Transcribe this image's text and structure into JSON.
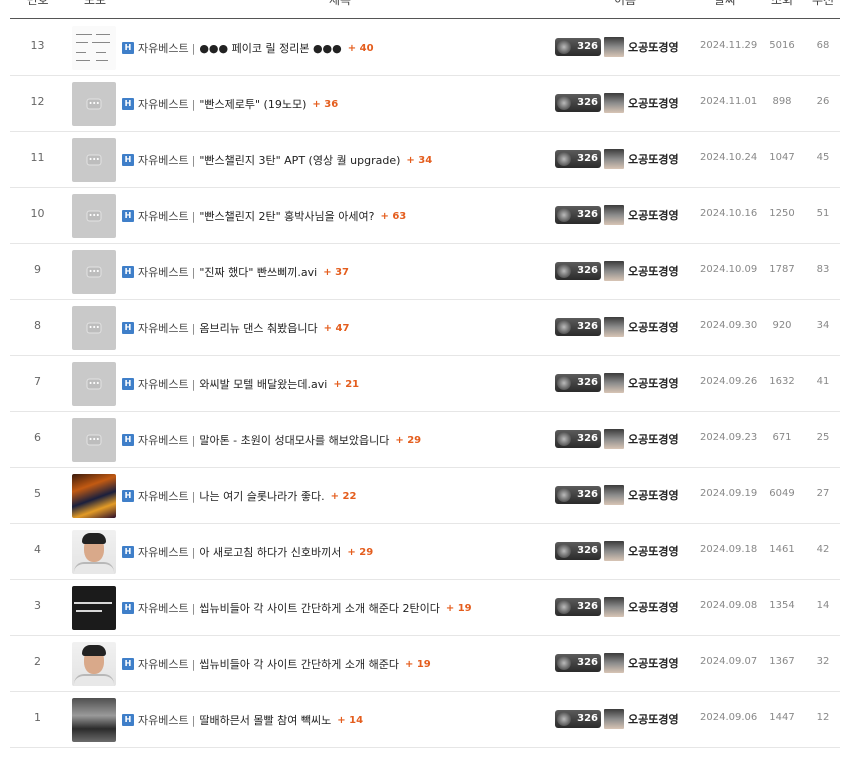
{
  "header": {
    "no": "번호",
    "thumb": "포토",
    "title": "제목",
    "name": "이름",
    "date": "날짜",
    "views": "조회",
    "likes": "추천"
  },
  "author": {
    "level": "326",
    "name": "오공또경영"
  },
  "posts": [
    {
      "no": "13",
      "thumb": "doc",
      "badge": "H",
      "category": "자유베스트",
      "sep": "|",
      "subject": "●●● 페이코 릴 정리본 ●●●",
      "comments": "+ 40",
      "date": "2024.11.29",
      "views": "5016",
      "likes": "68"
    },
    {
      "no": "12",
      "thumb": "placeholder",
      "badge": "H",
      "category": "자유베스트",
      "sep": "|",
      "subject": "\"빤스제로투\" (19노모)",
      "comments": "+ 36",
      "date": "2024.11.01",
      "views": "898",
      "likes": "26"
    },
    {
      "no": "11",
      "thumb": "placeholder",
      "badge": "H",
      "category": "자유베스트",
      "sep": "|",
      "subject": "\"빤스챌린지 3탄\" APT (영상 퀄 upgrade)",
      "comments": "+ 34",
      "date": "2024.10.24",
      "views": "1047",
      "likes": "45"
    },
    {
      "no": "10",
      "thumb": "placeholder",
      "badge": "H",
      "category": "자유베스트",
      "sep": "|",
      "subject": "\"빤스챌린지 2탄\" 홍박사님을 아세여?",
      "comments": "+ 63",
      "date": "2024.10.16",
      "views": "1250",
      "likes": "51"
    },
    {
      "no": "9",
      "thumb": "placeholder",
      "badge": "H",
      "category": "자유베스트",
      "sep": "|",
      "subject": "\"진짜 했다\" 빤쓰삐끼.avi",
      "comments": "+ 37",
      "date": "2024.10.09",
      "views": "1787",
      "likes": "83"
    },
    {
      "no": "8",
      "thumb": "placeholder",
      "badge": "H",
      "category": "자유베스트",
      "sep": "|",
      "subject": "옴브리뉴 댄스 춰봤읍니다",
      "comments": "+ 47",
      "date": "2024.09.30",
      "views": "920",
      "likes": "34"
    },
    {
      "no": "7",
      "thumb": "placeholder",
      "badge": "H",
      "category": "자유베스트",
      "sep": "|",
      "subject": "와씨발 모텔 배달왔는데.avi",
      "comments": "+ 21",
      "date": "2024.09.26",
      "views": "1632",
      "likes": "41"
    },
    {
      "no": "6",
      "thumb": "placeholder",
      "badge": "H",
      "category": "자유베스트",
      "sep": "|",
      "subject": "말아톤 - 초원이 성대모사를 해보았읍니다",
      "comments": "+ 29",
      "date": "2024.09.23",
      "views": "671",
      "likes": "25"
    },
    {
      "no": "5",
      "thumb": "game",
      "badge": "H",
      "category": "자유베스트",
      "sep": "|",
      "subject": "나는 여기 슬롯나라가 좋다.",
      "comments": "+ 22",
      "date": "2024.09.19",
      "views": "6049",
      "likes": "27"
    },
    {
      "no": "4",
      "thumb": "face",
      "badge": "H",
      "category": "자유베스트",
      "sep": "|",
      "subject": "아 새로고침 하다가 신호바끼서",
      "comments": "+ 29",
      "date": "2024.09.18",
      "views": "1461",
      "likes": "42"
    },
    {
      "no": "3",
      "thumb": "dark",
      "badge": "H",
      "category": "자유베스트",
      "sep": "|",
      "subject": "씹뉴비들아 각 사이트 간단하게 소개 해준다 2탄이다",
      "comments": "+ 19",
      "date": "2024.09.08",
      "views": "1354",
      "likes": "14"
    },
    {
      "no": "2",
      "thumb": "face",
      "badge": "H",
      "category": "자유베스트",
      "sep": "|",
      "subject": "씹뉴비들아 각 사이트 간단하게 소개 해준다",
      "comments": "+ 19",
      "date": "2024.09.07",
      "views": "1367",
      "likes": "32"
    },
    {
      "no": "1",
      "thumb": "car",
      "badge": "H",
      "category": "자유베스트",
      "sep": "|",
      "subject": "딸배하믄서 몰빨 참여 빽씨노",
      "comments": "+ 14",
      "date": "2024.09.06",
      "views": "1447",
      "likes": "12"
    }
  ]
}
